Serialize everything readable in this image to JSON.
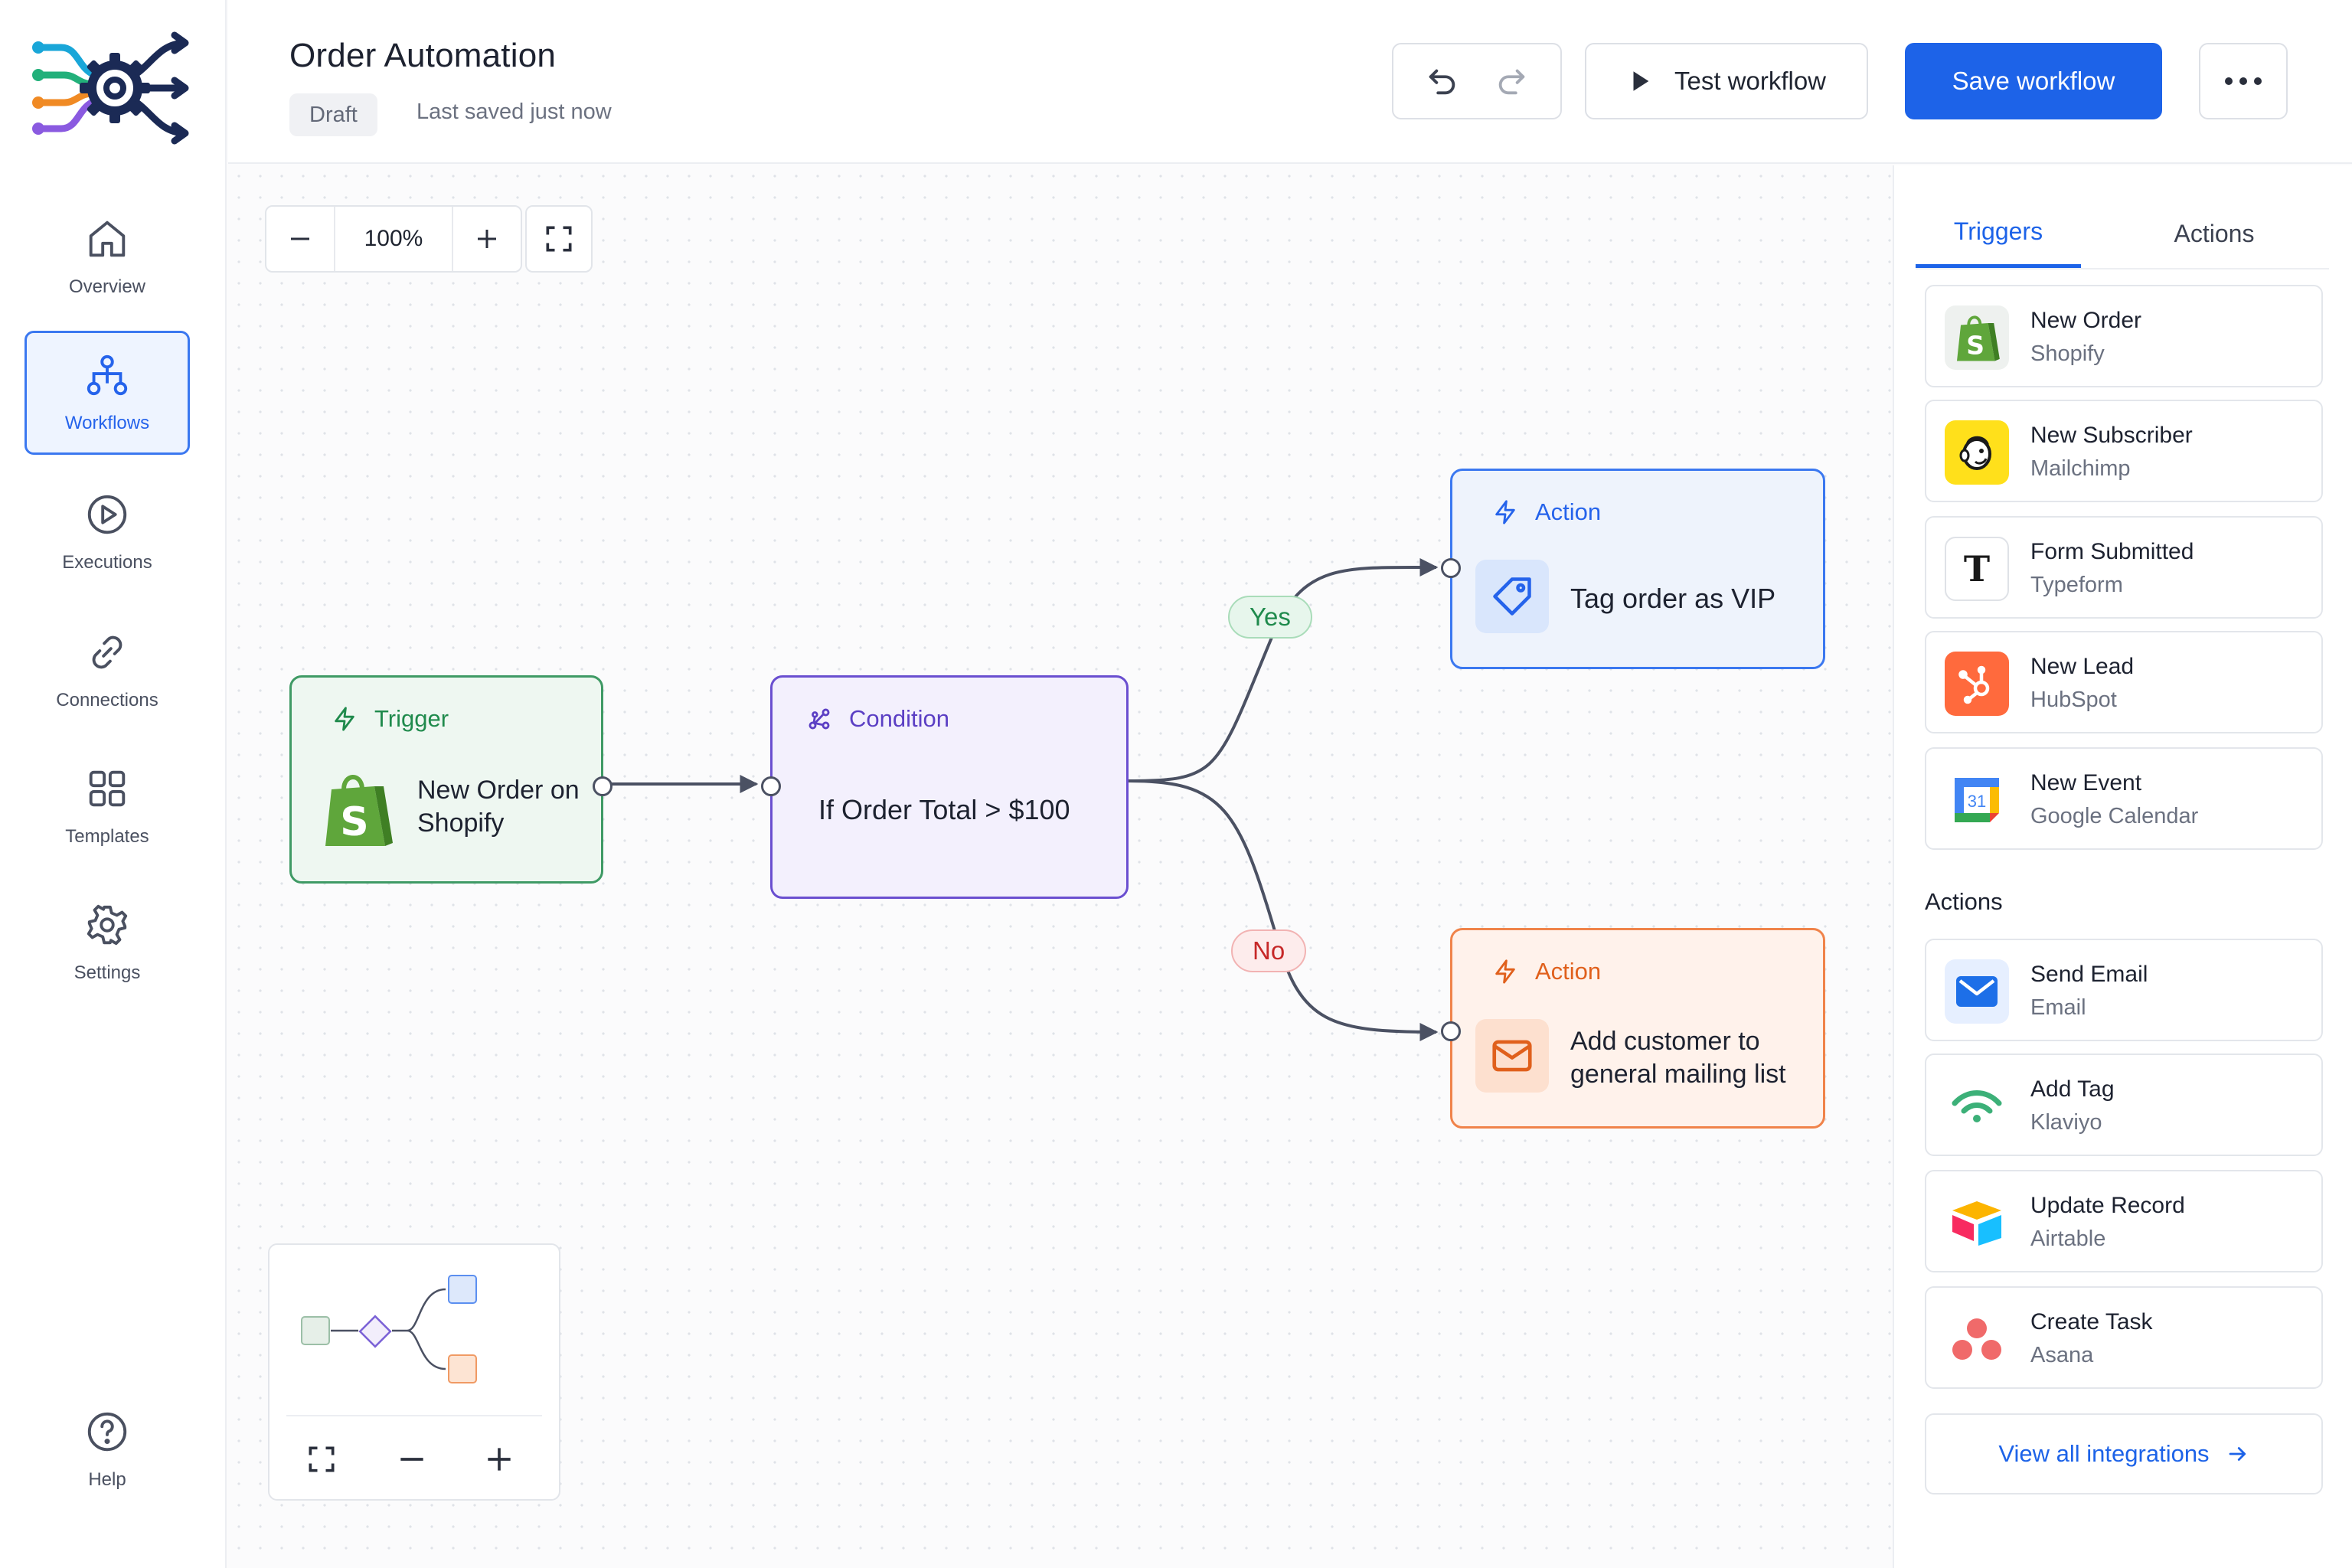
{
  "nav": {
    "items": [
      {
        "label": "Overview",
        "icon": "home-icon"
      },
      {
        "label": "Workflows",
        "icon": "workflow-icon",
        "active": true
      },
      {
        "label": "Executions",
        "icon": "play-circle-icon"
      },
      {
        "label": "Connections",
        "icon": "link-icon"
      },
      {
        "label": "Templates",
        "icon": "grid-icon"
      },
      {
        "label": "Settings",
        "icon": "gear-icon"
      }
    ],
    "help": "Help"
  },
  "header": {
    "title": "Order Automation",
    "status": "Draft",
    "last_saved": "Last saved just now",
    "test_label": "Test workflow",
    "save_label": "Save workflow"
  },
  "canvas": {
    "zoom": "100%",
    "nodes": {
      "trigger": {
        "kind": "Trigger",
        "text": "New Order on Shopify"
      },
      "condition": {
        "kind": "Condition",
        "text": "If Order Total > $100"
      },
      "action_vip": {
        "kind": "Action",
        "text": "Tag order as VIP"
      },
      "action_mail": {
        "kind": "Action",
        "text_line1": "Add customer to",
        "text_line2": "general mailing list"
      }
    },
    "edges": {
      "yes": "Yes",
      "no": "No"
    }
  },
  "panel": {
    "tabs": [
      "Triggers",
      "Actions"
    ],
    "triggers": [
      {
        "title": "New Order",
        "app": "Shopify"
      },
      {
        "title": "New Subscriber",
        "app": "Mailchimp"
      },
      {
        "title": "Form Submitted",
        "app": "Typeform"
      },
      {
        "title": "New Lead",
        "app": "HubSpot"
      },
      {
        "title": "New Event",
        "app": "Google Calendar"
      }
    ],
    "actions_title": "Actions",
    "actions": [
      {
        "title": "Send Email",
        "app": "Email"
      },
      {
        "title": "Add Tag",
        "app": "Klaviyo"
      },
      {
        "title": "Update Record",
        "app": "Airtable"
      },
      {
        "title": "Create Task",
        "app": "Asana"
      }
    ],
    "view_all": "View all integrations",
    "calendar_day": "31"
  },
  "colors": {
    "primary": "#1d63e8",
    "trigger": "#3f9a65",
    "condition": "#6a4fd0",
    "action_blue": "#3b78f0",
    "action_orange": "#f0834a"
  }
}
